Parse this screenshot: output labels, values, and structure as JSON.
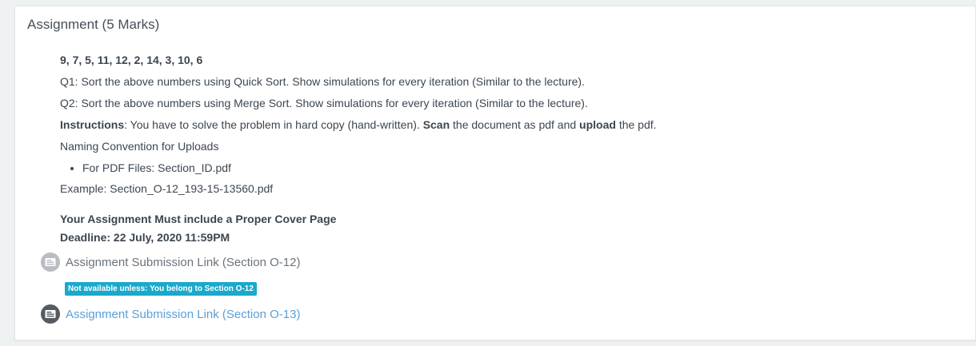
{
  "section": {
    "title": "Assignment (5 Marks)"
  },
  "summary": {
    "numbers": "9, 7, 5, 11, 12, 2, 14, 3, 10, 6",
    "q1": "Q1: Sort the above numbers using Quick Sort. Show simulations for every iteration (Similar to the lecture).",
    "q2": "Q2: Sort the above numbers using Merge Sort. Show simulations for every iteration (Similar to the lecture).",
    "instructions": {
      "label": "Instructions",
      "text1": ": You have to solve the problem in hard copy (hand-written). ",
      "scan": "Scan",
      "text2": " the document as pdf and ",
      "upload": "upload",
      "text3": " the pdf."
    },
    "naming_convention": "Naming Convention for Uploads",
    "bullet": "For PDF Files: Section_ID.pdf",
    "example": "Example: Section_O-12_193-15-13560.pdf",
    "cover_page": "Your Assignment Must include a Proper Cover Page",
    "deadline": "Deadline: 22 July, 2020 11:59PM"
  },
  "activities": [
    {
      "label": "Assignment Submission Link (Section O-12)",
      "available": false,
      "icon": "assignment-icon",
      "restriction": "Not available unless: You belong to Section O-12"
    },
    {
      "label": "Assignment Submission Link (Section O-13)",
      "available": true,
      "icon": "assignment-icon"
    }
  ],
  "colors": {
    "link": "#5aa0d8",
    "restriction_badge": "#19a9cc",
    "text": "#3c4650"
  }
}
